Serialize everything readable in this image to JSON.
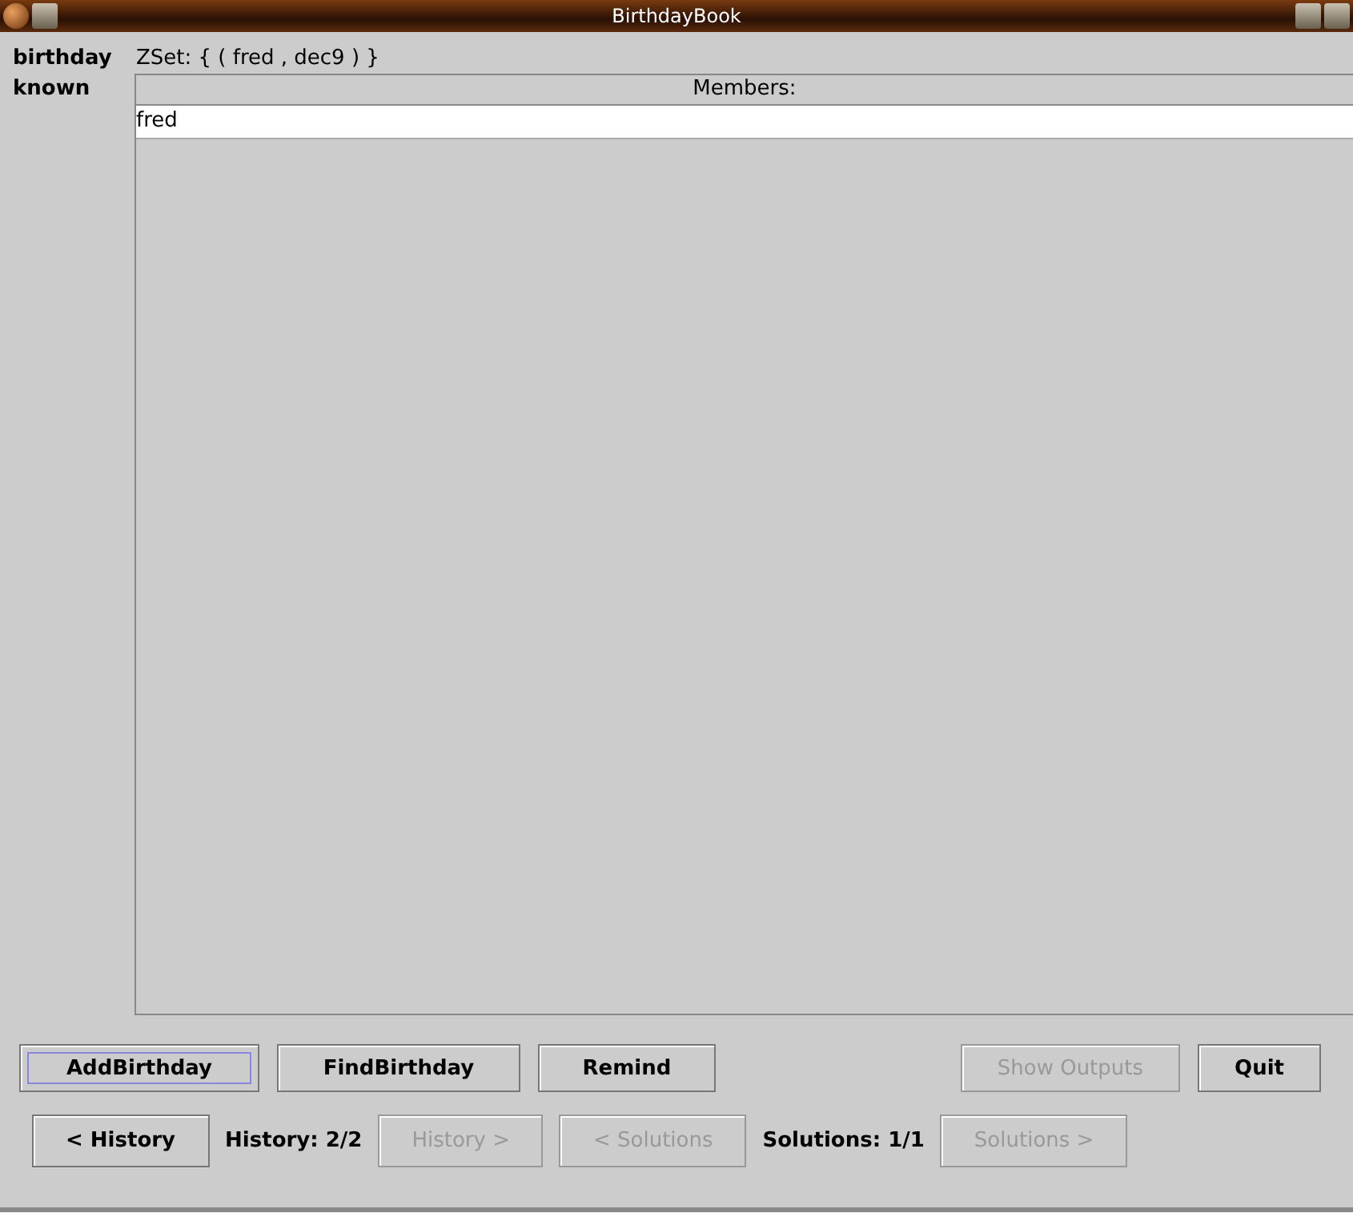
{
  "window": {
    "title": "BirthdayBook"
  },
  "birthday": {
    "label": "birthday",
    "value": "ZSet: { ( fred , dec9 ) }"
  },
  "known": {
    "label": "known",
    "table": {
      "columns": [
        "Members:"
      ],
      "rows": [
        [
          "fred"
        ]
      ]
    }
  },
  "operations": [
    {
      "label": "AddBirthday",
      "disabled": false,
      "focused": true
    },
    {
      "label": "FindBirthday",
      "disabled": false,
      "focused": false
    },
    {
      "label": "Remind",
      "disabled": false,
      "focused": false
    }
  ],
  "output_controls": [
    {
      "label": "Show Outputs",
      "disabled": true,
      "focused": false
    },
    {
      "label": "Quit",
      "disabled": false,
      "focused": false
    }
  ],
  "navigation": [
    {
      "kind": "button",
      "label": "< History",
      "disabled": false
    },
    {
      "kind": "text",
      "label": "History: 2/2"
    },
    {
      "kind": "button",
      "label": "History >",
      "disabled": true
    },
    {
      "kind": "button",
      "label": "< Solutions",
      "disabled": true
    },
    {
      "kind": "text",
      "label": "Solutions: 1/1"
    },
    {
      "kind": "button",
      "label": "Solutions >",
      "disabled": true
    }
  ]
}
